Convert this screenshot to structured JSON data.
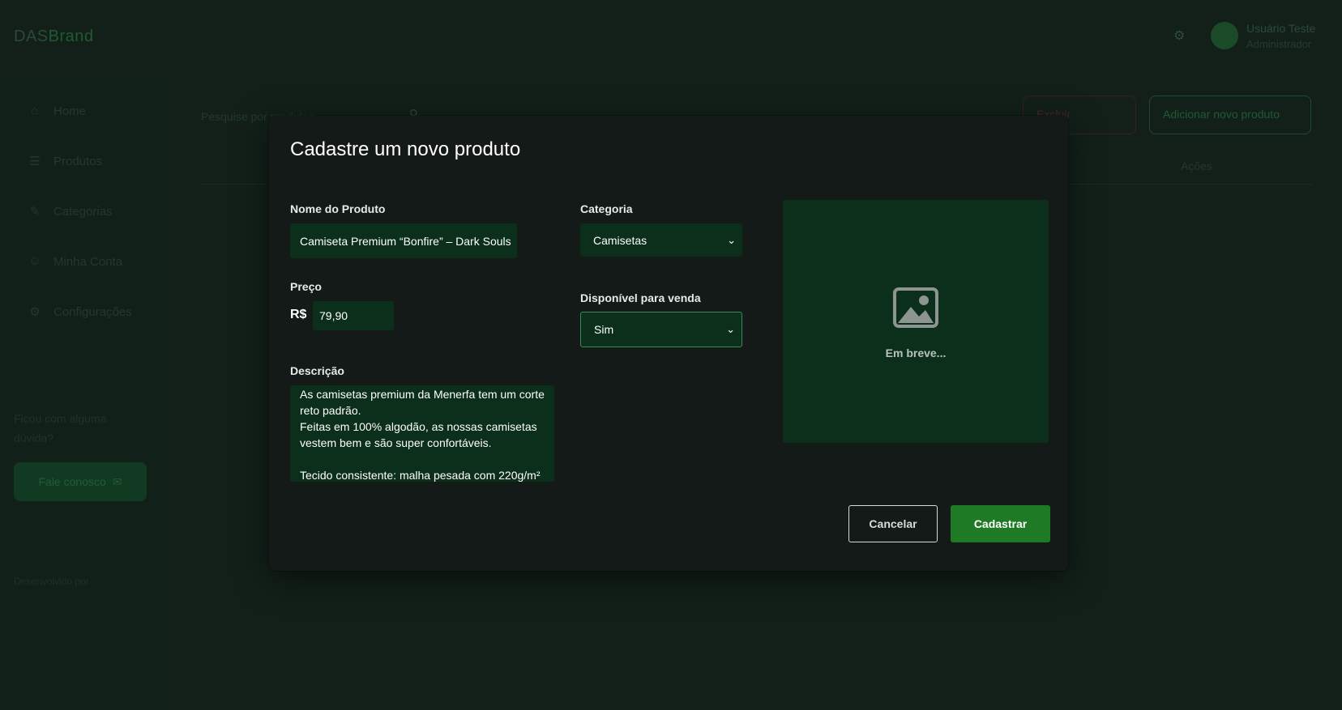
{
  "background": {
    "logo": {
      "part1": "DAS",
      "part2": "Brand"
    },
    "user": {
      "name": "Usuário Teste",
      "role": "Administrador"
    },
    "sidebar": {
      "items": [
        {
          "label": "Home",
          "icon": "home-icon"
        },
        {
          "label": "Produtos",
          "icon": "list-icon"
        },
        {
          "label": "Categorias",
          "icon": "edit-icon"
        },
        {
          "label": "Minha Conta",
          "icon": "user-icon"
        },
        {
          "label": "Configurações",
          "icon": "gear-icon"
        }
      ],
      "help_text": "Ficou com alguma dúvida?",
      "help_button": "Fale conosco",
      "dev_label": "Desenvolvido por",
      "dev_link": "",
      "version": ""
    },
    "search_placeholder": "Pesquise por produtos",
    "delete_button": "Excluir",
    "add_button": "Adicionar novo produto",
    "table_col_acoes": "Ações"
  },
  "modal": {
    "title": "Cadastre um novo produto",
    "fields": {
      "name": {
        "label": "Nome do Produto",
        "value": "Camiseta Premium “Bonfire” – Dark Souls"
      },
      "price": {
        "label": "Preço",
        "currency": "R$",
        "value": "79,90"
      },
      "description": {
        "label": "Descrição",
        "value": "As camisetas premium da Menerfa tem um corte reto padrão.\nFeitas em 100% algodão, as nossas camisetas vestem bem e são super confortáveis.\n\nTecido consistente: malha pesada com 220g/m²"
      },
      "category": {
        "label": "Categoria",
        "value": "Camisetas"
      },
      "available": {
        "label": "Disponível para venda",
        "value": "Sim"
      }
    },
    "image_placeholder": {
      "icon": "image-icon",
      "text": "Em breve..."
    },
    "buttons": {
      "cancel": "Cancelar",
      "submit": "Cadastrar"
    }
  },
  "colors": {
    "field_bg": "#0b2f1a",
    "primary": "#1f7a25",
    "modal_bg": "#141a17"
  }
}
